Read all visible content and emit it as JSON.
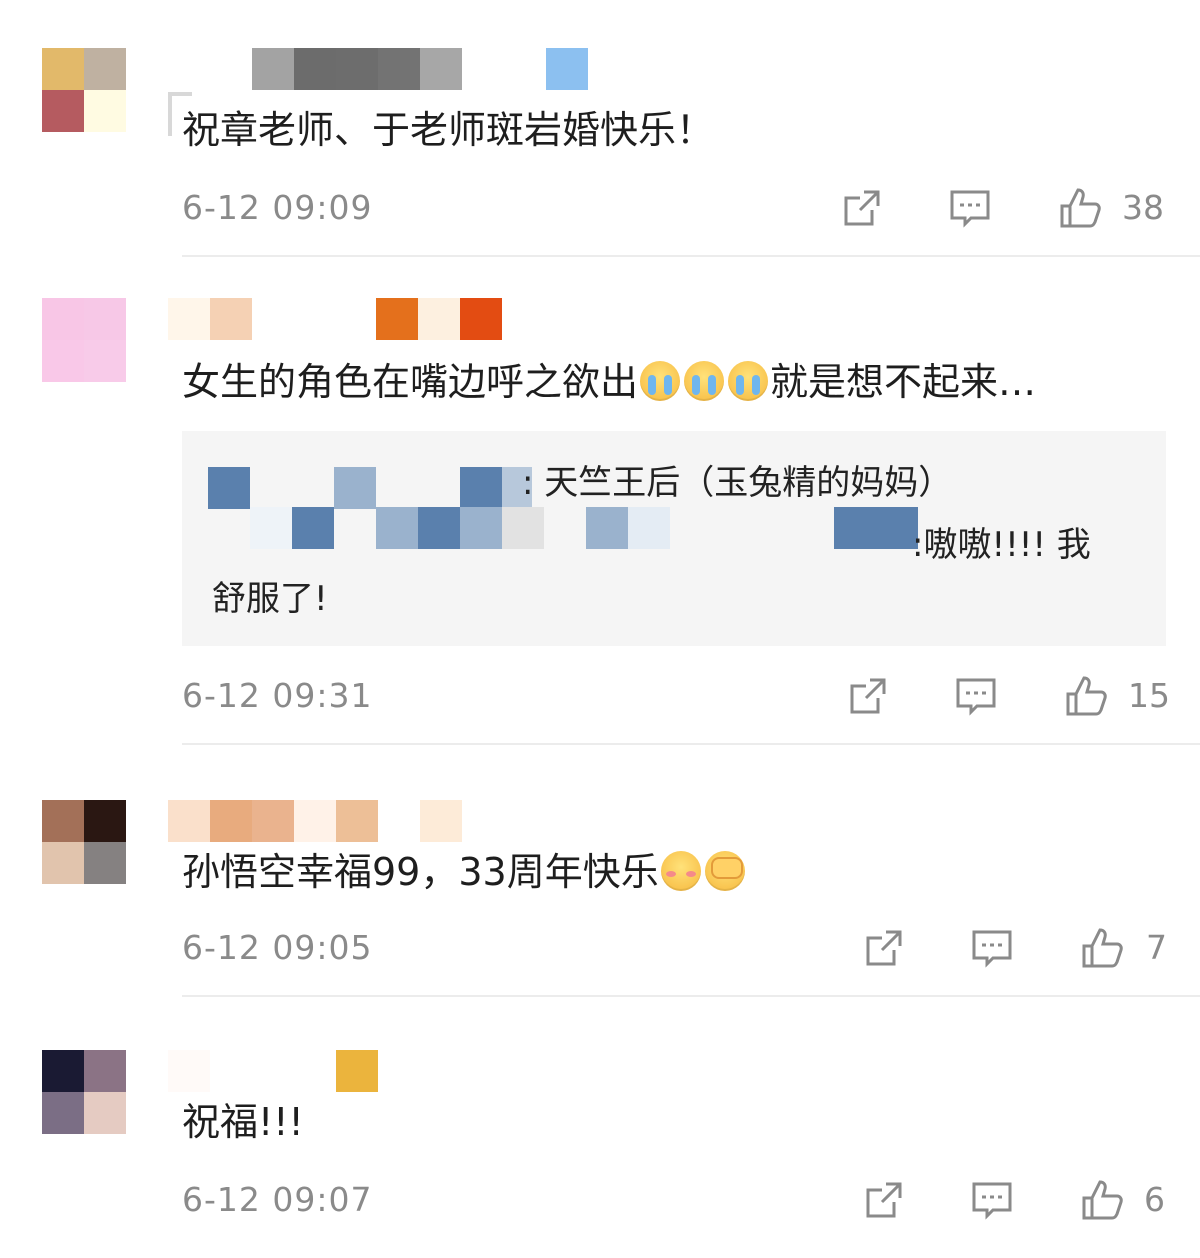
{
  "comments": [
    {
      "text": "祝章老师、于老师斑岩婚快乐！",
      "time": "6-12 09:09",
      "likes": "38",
      "avatar_colors": [
        "#e2b96a",
        "#bfb1a1",
        "#b55b60",
        "#fffbe2"
      ],
      "name_mosaic_colors": [
        "#ffffff",
        "#ffffff",
        "#a3a3a3",
        "#6c6c6c",
        "#6d6d6d",
        "#737373",
        "#a7a7a7",
        "#ffffff",
        "#ffffff",
        "#8cc0f0"
      ]
    },
    {
      "text_before": "女生的角色在嘴边呼之欲出",
      "text_after": "就是想不起来…",
      "emoji": [
        "crying-face",
        "crying-face",
        "crying-face"
      ],
      "quote": {
        "line1_text": ": 天竺王后（玉兔精的妈妈）",
        "line2_text": ":嗷嗷!!!! 我",
        "line3_text": "舒服了!"
      },
      "time": "6-12 09:31",
      "likes": "15",
      "avatar_colors": [
        "#f8c6e6",
        "#f7c8e7",
        "#f9c8e8",
        "#f8cbe9"
      ],
      "name_mosaic_colors": [
        "#fff6ea",
        "#f5d1b4",
        "#ffffff",
        "#ffffff",
        "#ffffff",
        "#e4701c",
        "#fdf0e0",
        "#e34c12"
      ]
    },
    {
      "text": "孙悟空幸福99，33周年快乐",
      "emoji": [
        "shy-face",
        "covering-face"
      ],
      "time": "6-12 09:05",
      "likes": "7",
      "avatar_colors": [
        "#a37058",
        "#2a1712",
        "#e1c4ad",
        "#858181"
      ],
      "name_mosaic_colors": [
        "#fae0cb",
        "#e8ab7e",
        "#eab38e",
        "#fff2e8",
        "#edbf97",
        "#ffffff",
        "#fdebd8"
      ]
    },
    {
      "text": "祝福!!!",
      "time": "6-12 09:07",
      "likes": "6",
      "avatar_colors": [
        "#1a1a33",
        "#8b7385",
        "#7b6e85",
        "#e5cbc2"
      ],
      "name_mosaic_colors": [
        "#fffaf8",
        "#ffffff",
        "#ffffff",
        "#ffffff",
        "#ffffff",
        "#ebb43d"
      ]
    }
  ],
  "icons": {
    "share": "share-icon",
    "reply": "reply-icon",
    "like": "like-icon"
  },
  "colors": {
    "text": "#1e1e1e",
    "meta": "#8a8a8a",
    "quote_bg": "#f5f5f5",
    "divider": "#ececec",
    "mosaic_blue": "#5a80ad"
  }
}
